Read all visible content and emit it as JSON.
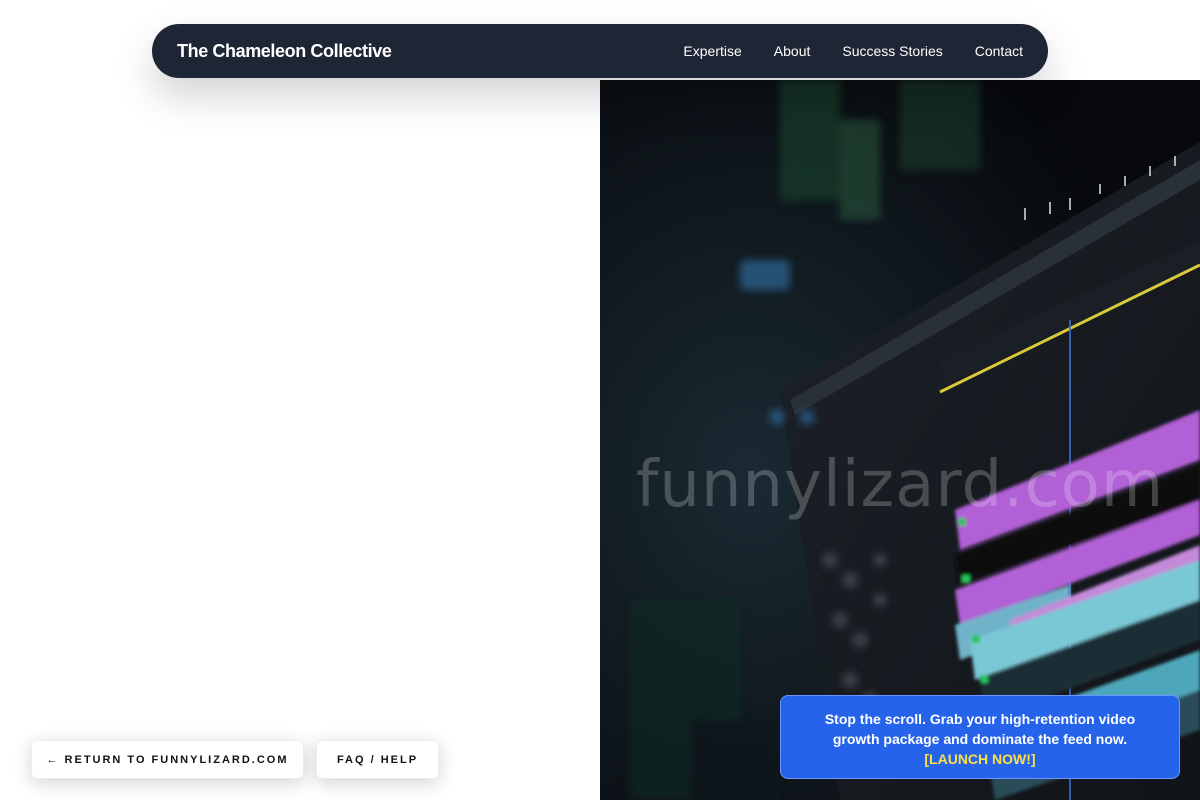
{
  "navbar": {
    "brand": "The Chameleon Collective",
    "links": [
      "Expertise",
      "About",
      "Success Stories",
      "Contact"
    ]
  },
  "hero": {
    "image_subject": "video editing timeline on monitor",
    "watermark": "funnylizard.com"
  },
  "buttons": {
    "return_label": "← RETURN TO FUNNYLIZARD.COM",
    "faq_label": "FAQ / HELP"
  },
  "promo": {
    "text": "Stop the scroll. Grab your high-retention video growth package and dominate the feed now.",
    "cta": "[LAUNCH NOW!]"
  },
  "colors": {
    "navbar_bg": "#1e2635",
    "promo_bg": "#2563eb",
    "cta_yellow": "#fde047"
  },
  "icons": {
    "return_arrow": "left-arrow-icon"
  }
}
